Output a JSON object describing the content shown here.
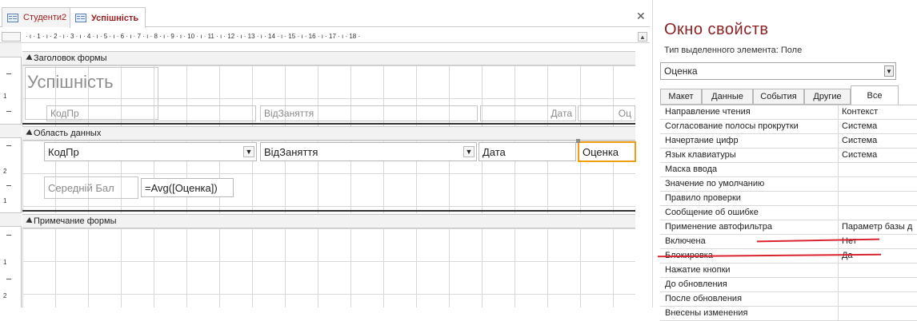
{
  "tabs": [
    {
      "label": "Студенти2"
    },
    {
      "label": "Успішність"
    }
  ],
  "ruler_text": "· ı · 1 · ı · 2 · ı · 3 · ı · 4 · ı · 5 · ı · 6 · ı · 7 · ı · 8 · ı · 9 · ı · 10 · ı · 11 · ı · 12 · ı · 13 · ı · 14 · ı · 15 · ı · 16 · ı · 17 · ı · 18 ·",
  "vruler": [
    "1",
    "2",
    "1",
    "2"
  ],
  "sections": {
    "header": "Заголовок формы",
    "detail": "Область данных",
    "footer": "Примечание формы"
  },
  "header_controls": {
    "title": "Успішність",
    "label_kod": "КодПр",
    "label_vid": "ВідЗаняття",
    "label_data": "Дата",
    "label_otsinka": "Оц"
  },
  "detail_controls": {
    "kod": "КодПр",
    "vid": "ВідЗаняття",
    "data": "Дата",
    "otsinka": "Оценка",
    "avg_label": "Середній Бал",
    "avg_expr": "=Avg([Оценка])"
  },
  "property_sheet": {
    "title": "Окно свойств",
    "type_label": "Тип выделенного элемента:  Поле",
    "selected_control": "Оценка",
    "tabs": [
      "Макет",
      "Данные",
      "События",
      "Другие",
      "Все"
    ],
    "rows": [
      {
        "name": "Направление чтения",
        "value": "Контекст"
      },
      {
        "name": "Согласование полосы прокрутки",
        "value": "Система"
      },
      {
        "name": "Начертание цифр",
        "value": "Система"
      },
      {
        "name": "Язык клавиатуры",
        "value": "Система"
      },
      {
        "name": "Маска ввода",
        "value": ""
      },
      {
        "name": "Значение по умолчанию",
        "value": ""
      },
      {
        "name": "Правило проверки",
        "value": ""
      },
      {
        "name": "Сообщение об ошибке",
        "value": ""
      },
      {
        "name": "Применение автофильтра",
        "value": "Параметр базы д"
      },
      {
        "name": "Включена",
        "value": "Нет"
      },
      {
        "name": "Блокировка",
        "value": "Да"
      },
      {
        "name": "Нажатие кнопки",
        "value": ""
      },
      {
        "name": "До обновления",
        "value": ""
      },
      {
        "name": "После обновления",
        "value": ""
      },
      {
        "name": "Внесены изменения",
        "value": ""
      }
    ]
  },
  "colors": {
    "selection_border": "#f39c12",
    "title_red": "#8b2222",
    "underline_red": "#d9252f"
  }
}
